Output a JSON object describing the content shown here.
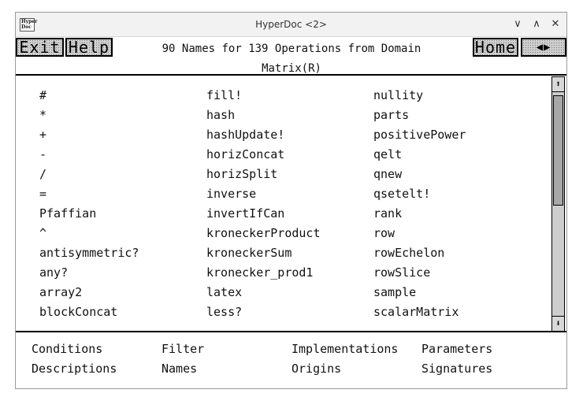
{
  "window": {
    "title": "HyperDoc <2>",
    "icon_text": [
      "Hyper",
      "Doc"
    ]
  },
  "window_controls": {
    "minimize": "∨",
    "maximize": "∧",
    "close": "✕"
  },
  "header": {
    "exit_label": "Exit",
    "help_label": "Help",
    "home_label": "Home",
    "back_label": "◀▶",
    "title_line1": "90 Names for 139 Operations from Domain",
    "title_line2": "Matrix(R)"
  },
  "columns": [
    [
      "#",
      "*",
      "+",
      "-",
      "/",
      "=",
      "Pfaffian",
      "^",
      "antisymmetric?",
      "any?",
      "array2",
      "blockConcat"
    ],
    [
      "fill!",
      "hash",
      "hashUpdate!",
      "horizConcat",
      "horizSplit",
      "inverse",
      "invertIfCan",
      "kroneckerProduct",
      "kroneckerSum",
      "kronecker_prod1",
      "latex",
      "less?"
    ],
    [
      "nullity",
      "parts",
      "positivePower",
      "qelt",
      "qnew",
      "qsetelt!",
      "rank",
      "row",
      "rowEchelon",
      "rowSlice",
      "sample",
      "scalarMatrix"
    ]
  ],
  "footer": {
    "row1": [
      "Conditions",
      "Filter",
      "Implementations",
      "Parameters"
    ],
    "row2": [
      "Descriptions",
      "Names",
      "Origins",
      "Signatures"
    ]
  },
  "scrollbar": {
    "up_arrow": "⬆",
    "down_arrow": "⬇",
    "position": 0.0
  }
}
